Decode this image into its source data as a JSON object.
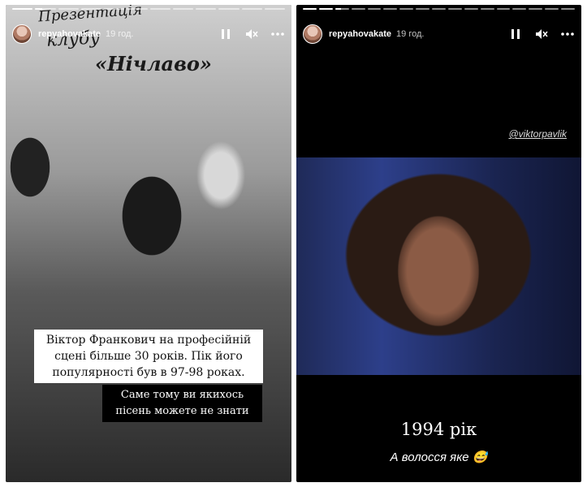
{
  "left_story": {
    "progress": [
      1,
      0.35,
      0,
      0,
      0,
      0,
      0,
      0,
      0,
      0,
      0,
      0
    ],
    "username": "repyahovakate",
    "time": "19 год.",
    "banner": {
      "line1": "Презентація",
      "line2": "клубу",
      "line3": "«Нічлаво»"
    },
    "caption_main": "Віктор Франкович на професійній сцені більше 30 років. Пік його популярності був в 97-98 роках.",
    "caption_secondary": "Саме тому ви якихось пісень можете не знати"
  },
  "right_story": {
    "progress": [
      1,
      1,
      0.4,
      0,
      0,
      0,
      0,
      0,
      0,
      0,
      0,
      0,
      0,
      0,
      0,
      0,
      0
    ],
    "username": "repyahovakate",
    "time": "19 год.",
    "mention": "@viktorpavlik",
    "year_caption": "1994 рік",
    "subtitle": "А волосся яке 😅"
  },
  "icons": {
    "pause": "pause-icon",
    "mute": "mute-icon",
    "more": "more-icon"
  }
}
